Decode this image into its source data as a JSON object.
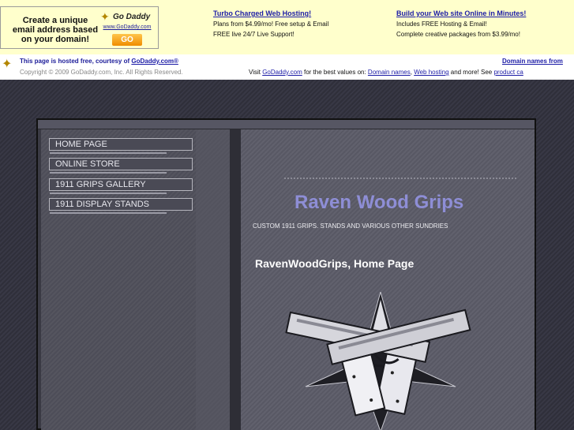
{
  "ad": {
    "box_text": "Create a unique email address based on your domain!",
    "logo_brand": "Go Daddy",
    "logo_url": "www.GoDaddy.com",
    "go_label": "GO",
    "promo1": {
      "headline": "Turbo Charged Web Hosting!",
      "line1": "Plans from $4.99/mo! Free setup & Email",
      "line2": "FREE live 24/7 Live Support!"
    },
    "promo2": {
      "headline": "Build your Web site Online in Minutes!",
      "line1": "Includes FREE Hosting & Email!",
      "line2": "Complete creative packages from $3.99/mo!"
    }
  },
  "host_bar": {
    "line1_text": "This page is hosted free, courtesy of ",
    "line1_link": "GoDaddy.com®",
    "copyright": "Copyright © 2009 GoDaddy.com, Inc. All Rights Reserved.",
    "right_link": "Domain names from",
    "visit_prefix": "Visit ",
    "visit_link": "GoDaddy.com",
    "visit_mid": " for the best values on: ",
    "visit_domain": "Domain names",
    "comma": ", ",
    "visit_hosting": "Web hosting",
    "visit_tail": " and more! See ",
    "visit_product": "product ca"
  },
  "nav": {
    "items": [
      {
        "label": "HOME PAGE"
      },
      {
        "label": "ONLINE STORE"
      },
      {
        "label": "1911 GRIPS GALLERY"
      },
      {
        "label": "1911 DISPLAY STANDS"
      }
    ]
  },
  "main": {
    "title": "Raven Wood Grips",
    "tagline": "CUSTOM 1911 GRIPS. STANDS AND VARIOUS OTHER SUNDRIES",
    "page_heading": "RavenWoodGrips, Home Page"
  },
  "colors": {
    "ad_bg": "#ffffcc",
    "link": "#1c1ca6",
    "title": "#8e8ed6"
  }
}
